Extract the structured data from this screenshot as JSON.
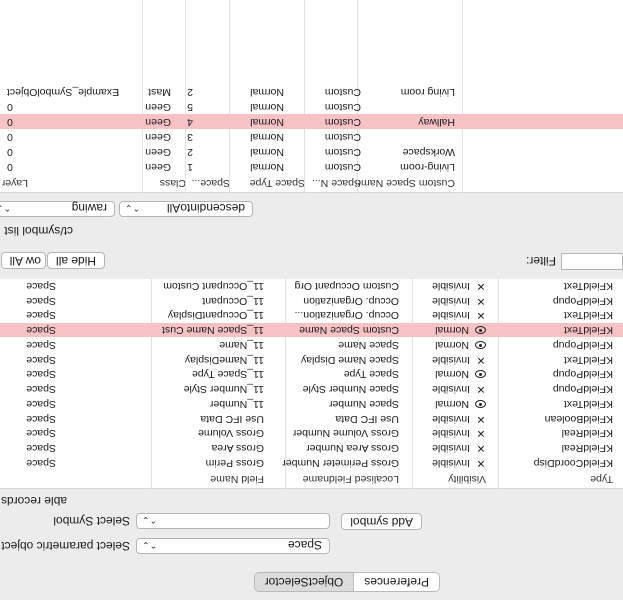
{
  "tabs": [
    {
      "label": "Preferences",
      "selected": false
    },
    {
      "label": "ObjectSelector",
      "selected": true
    }
  ],
  "parametric": {
    "label": "Select parametric object",
    "value": "Space"
  },
  "symbol": {
    "label": "Select Symbol",
    "value": "",
    "add_button": "Add symbol"
  },
  "records_title": "able records",
  "fields_table": {
    "headers": [
      "Type",
      "Visibility",
      "Localised Fieldname",
      "Field Name",
      ""
    ],
    "rows": [
      {
        "type": "KFieldCoordDisp",
        "visibility": "Invisible",
        "vis_icon": "x",
        "localised": "Gross Perimeter Number",
        "field": "Gross Perim",
        "object": "Space"
      },
      {
        "type": "KFieldReal",
        "visibility": "Invisible",
        "vis_icon": "x",
        "localised": "Gross Area Number",
        "field": "Gross Area",
        "object": "Space"
      },
      {
        "type": "KFieldReal",
        "visibility": "Invisible",
        "vis_icon": "x",
        "localised": "Gross Volume Number",
        "field": "Gross Volume",
        "object": "Space"
      },
      {
        "type": "KFieldBoolean",
        "visibility": "Invisible",
        "vis_icon": "x",
        "localised": "Use IFC Data",
        "field": "Use IFC Data",
        "object": "Space"
      },
      {
        "type": "KFieldText",
        "visibility": "Normal",
        "vis_icon": "eye",
        "localised": "Space Number",
        "field": "11_Number",
        "object": "Space"
      },
      {
        "type": "KFieldPopup",
        "visibility": "Invisible",
        "vis_icon": "x",
        "localised": "Space Number Style",
        "field": "11_Number Style",
        "object": "Space"
      },
      {
        "type": "KFieldPopup",
        "visibility": "Normal",
        "vis_icon": "eye",
        "localised": "Space Type",
        "field": "11_Space Type",
        "object": "Space"
      },
      {
        "type": "KFieldText",
        "visibility": "Invisible",
        "vis_icon": "x",
        "localised": "Space Name Display",
        "field": "11_NameDisplay",
        "object": "Space"
      },
      {
        "type": "KFieldPopup",
        "visibility": "Normal",
        "vis_icon": "eye",
        "localised": "Space Name",
        "field": "11_Name",
        "object": "Space"
      },
      {
        "type": "KFieldText",
        "visibility": "Normal",
        "vis_icon": "eye",
        "localised": "Custom Space Name",
        "field": "11_Space Name Cust",
        "object": "Space",
        "selected": true
      },
      {
        "type": "KFieldText",
        "visibility": "Invisible",
        "vis_icon": "x",
        "localised": "Occup. Organization...",
        "field": "11_OccupantDisplay",
        "object": "Space"
      },
      {
        "type": "KFieldPopup",
        "visibility": "Invisible",
        "vis_icon": "x",
        "localised": "Occup. Organization",
        "field": "11_Occupant",
        "object": "Space"
      },
      {
        "type": "KFieldText",
        "visibility": "Invisible",
        "vis_icon": "x",
        "localised": "Custom Occupant Org",
        "field": "11_Occupant Custom",
        "object": "Space"
      }
    ]
  },
  "filter_label": "Filter:",
  "hide_all": "Hide all",
  "show_all": "ow All",
  "list_title": "ct/symbol list",
  "scope_popup": "descendintoAll",
  "source_popup": "rawing",
  "objects_table": {
    "headers": [
      "Custom Space Name",
      "Space N...",
      "Space Type",
      "Space...",
      "Class",
      "Layer"
    ],
    "rows": [
      {
        "custom": "Living-room",
        "spacen": "Custom",
        "type": "Normal",
        "space": "1",
        "cls": "Geen",
        "layer": "0"
      },
      {
        "custom": "Workspace",
        "spacen": "Custom",
        "type": "Normal",
        "space": "2",
        "cls": "Geen",
        "layer": "0"
      },
      {
        "custom": "",
        "spacen": "Custom",
        "type": "Normal",
        "space": "3",
        "cls": "Geen",
        "layer": "0"
      },
      {
        "custom": "Hallway",
        "spacen": "Custom",
        "type": "Normal",
        "space": "4",
        "cls": "Geen",
        "layer": "0",
        "selected": true
      },
      {
        "custom": "",
        "spacen": "Custom",
        "type": "Normal",
        "space": "5",
        "cls": "Geen",
        "layer": "0"
      },
      {
        "custom": "Living room",
        "spacen": "Custom",
        "type": "Normal",
        "space": "2",
        "cls": "Mast",
        "layer": "Example_SymbolObject"
      }
    ]
  }
}
